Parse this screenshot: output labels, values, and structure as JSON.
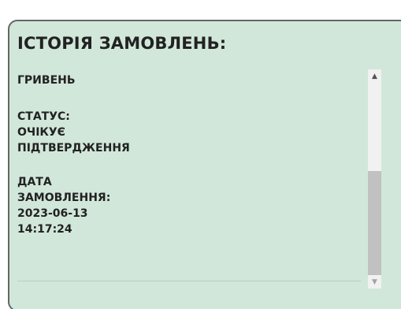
{
  "panel": {
    "title": "ІСТОРІЯ ЗАМОВЛЕНЬ:"
  },
  "order": {
    "currency": "ГРИВЕНЬ",
    "status_label": "СТАТУС:",
    "status_value_line1": "ОЧІКУЄ",
    "status_value_line2": "ПІДТВЕРДЖЕННЯ",
    "date_label_line1": "ДАТА",
    "date_label_line2": "ЗАМОВЛЕННЯ:",
    "date": "2023-06-13",
    "time": "14:17:24"
  },
  "scrollbar": {
    "up_arrow": "▲",
    "down_arrow": "▼",
    "thumb_start_fraction": 0.46,
    "thumb_size_fraction": 0.54
  },
  "colors": {
    "panel_background": "#d1e7da",
    "panel_border": "#666666",
    "text": "#222222"
  }
}
